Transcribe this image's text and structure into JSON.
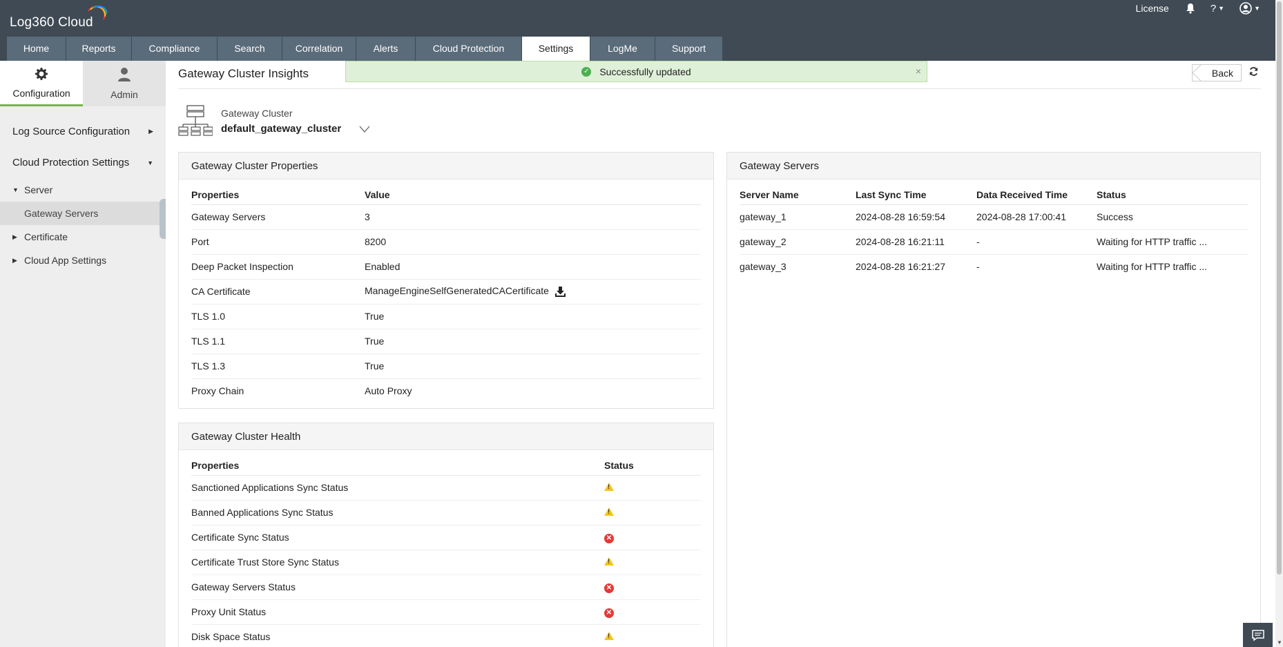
{
  "app": {
    "logo_text": "Log360 Cloud"
  },
  "header": {
    "license_label": "License",
    "help_label": "?",
    "icons": [
      "bell-icon",
      "help-icon",
      "user-icon"
    ]
  },
  "tabs": [
    {
      "label": "Home"
    },
    {
      "label": "Reports"
    },
    {
      "label": "Compliance"
    },
    {
      "label": "Search"
    },
    {
      "label": "Correlation"
    },
    {
      "label": "Alerts"
    },
    {
      "label": "Cloud Protection"
    },
    {
      "label": "Settings",
      "active": true
    },
    {
      "label": "LogMe"
    },
    {
      "label": "Support"
    }
  ],
  "sidebar": {
    "tabs": [
      {
        "label": "Configuration",
        "icon": "gear-icon",
        "active": true
      },
      {
        "label": "Admin",
        "icon": "user-icon"
      }
    ],
    "sections": [
      {
        "label": "Log Source Configuration"
      },
      {
        "label": "Cloud Protection Settings"
      }
    ],
    "items": [
      {
        "label": "Server"
      },
      {
        "label": "Gateway Servers",
        "selected": true
      },
      {
        "label": "Certificate"
      },
      {
        "label": "Cloud App Settings"
      }
    ]
  },
  "page": {
    "title": "Gateway Cluster Insights",
    "toast": "Successfully updated",
    "toast_close": "×",
    "back_label": "Back",
    "cluster_label": "Gateway Cluster",
    "cluster_name": "default_gateway_cluster"
  },
  "properties_panel": {
    "title": "Gateway Cluster Properties",
    "columns": [
      "Properties",
      "Value"
    ],
    "rows": [
      {
        "name": "Gateway Servers",
        "value": "3"
      },
      {
        "name": "Port",
        "value": "8200"
      },
      {
        "name": "Deep Packet Inspection",
        "value": "Enabled"
      },
      {
        "name": "CA Certificate",
        "value": "ManageEngineSelfGeneratedCACertificate"
      },
      {
        "name": "TLS 1.0",
        "value": "True"
      },
      {
        "name": "TLS 1.1",
        "value": "True"
      },
      {
        "name": "TLS 1.3",
        "value": "True"
      },
      {
        "name": "Proxy Chain",
        "value": "Auto Proxy"
      }
    ]
  },
  "health_panel": {
    "title": "Gateway Cluster Health",
    "columns": [
      "Properties",
      "Status"
    ],
    "rows": [
      {
        "name": "Sanctioned Applications Sync Status",
        "status": "warning"
      },
      {
        "name": "Banned Applications Sync Status",
        "status": "warning"
      },
      {
        "name": "Certificate Sync Status",
        "status": "error"
      },
      {
        "name": "Certificate Trust Store Sync Status",
        "status": "warning"
      },
      {
        "name": "Gateway Servers Status",
        "status": "error"
      },
      {
        "name": "Proxy Unit Status",
        "status": "error"
      },
      {
        "name": "Disk Space Status",
        "status": "warning"
      }
    ]
  },
  "servers_panel": {
    "title": "Gateway Servers",
    "columns": [
      "Server Name",
      "Last Sync Time",
      "Data Received Time",
      "Status"
    ],
    "rows": [
      {
        "name": "gateway_1",
        "last_sync": "2024-08-28 16:59:54",
        "data_received": "2024-08-28 17:00:41",
        "status": "Success",
        "status_type": "success"
      },
      {
        "name": "gateway_2",
        "last_sync": "2024-08-28 16:21:11",
        "data_received": "-",
        "status": "Waiting for HTTP traffic ...",
        "status_type": "waiting"
      },
      {
        "name": "gateway_3",
        "last_sync": "2024-08-28 16:21:27",
        "data_received": "-",
        "status": "Waiting for HTTP traffic ...",
        "status_type": "waiting"
      }
    ]
  },
  "colors": {
    "header_bg": "#3f4a54",
    "tab_bg": "#5a6b7a",
    "accent_green": "#7cb342",
    "success": "#6aaa1e",
    "waiting": "#e08a1e",
    "warning": "#f5c518",
    "error": "#e53935"
  }
}
